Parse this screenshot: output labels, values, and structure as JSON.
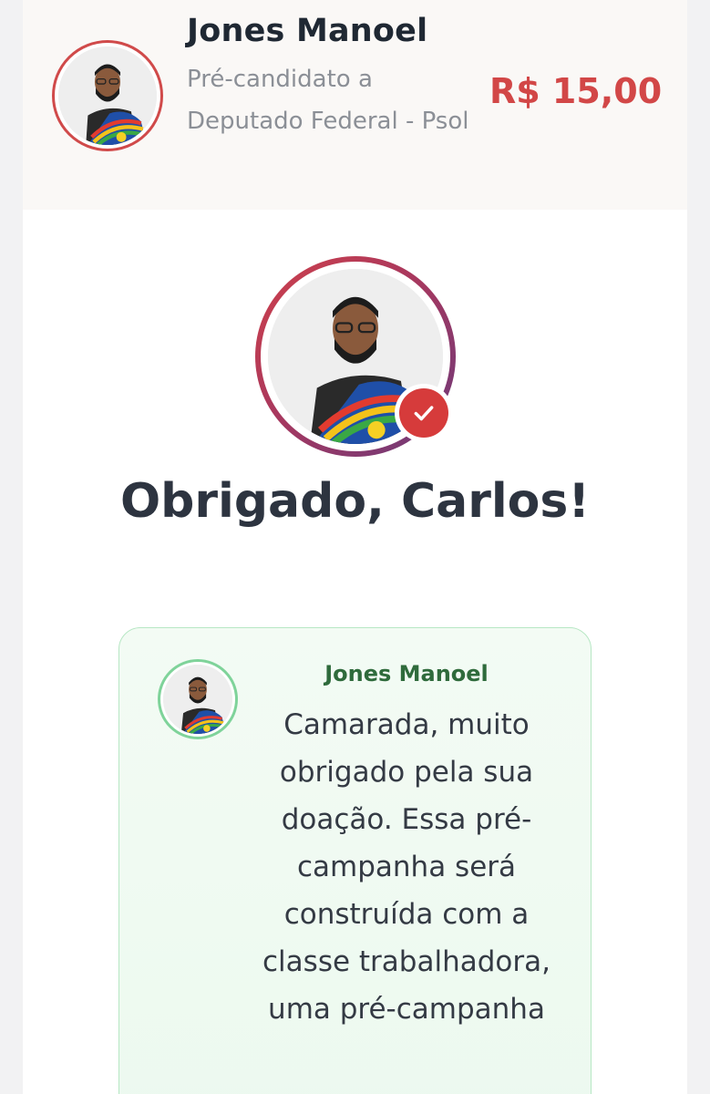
{
  "header": {
    "candidate_name": "Jones Manoel",
    "candidate_role": "Pré-candidato a Deputado Federal - Psol",
    "amount": "R$ 15,00"
  },
  "hero": {
    "thanks_title": "Obrigado, Carlos!"
  },
  "message": {
    "author": "Jones Manoel",
    "text": "Camarada, muito obrigado pela sua doação. Essa pré-campanha será construída com a classe trabalhadora, uma pré-campanha"
  },
  "colors": {
    "accent_red": "#d24747",
    "title_dark": "#2d3440",
    "card_green_border": "#b7e7c4",
    "author_green": "#2f6b3c"
  },
  "icons": {
    "header_avatar": "candidate-photo",
    "hero_avatar": "candidate-photo",
    "badge": "checkmark-icon",
    "message_avatar": "candidate-photo"
  }
}
